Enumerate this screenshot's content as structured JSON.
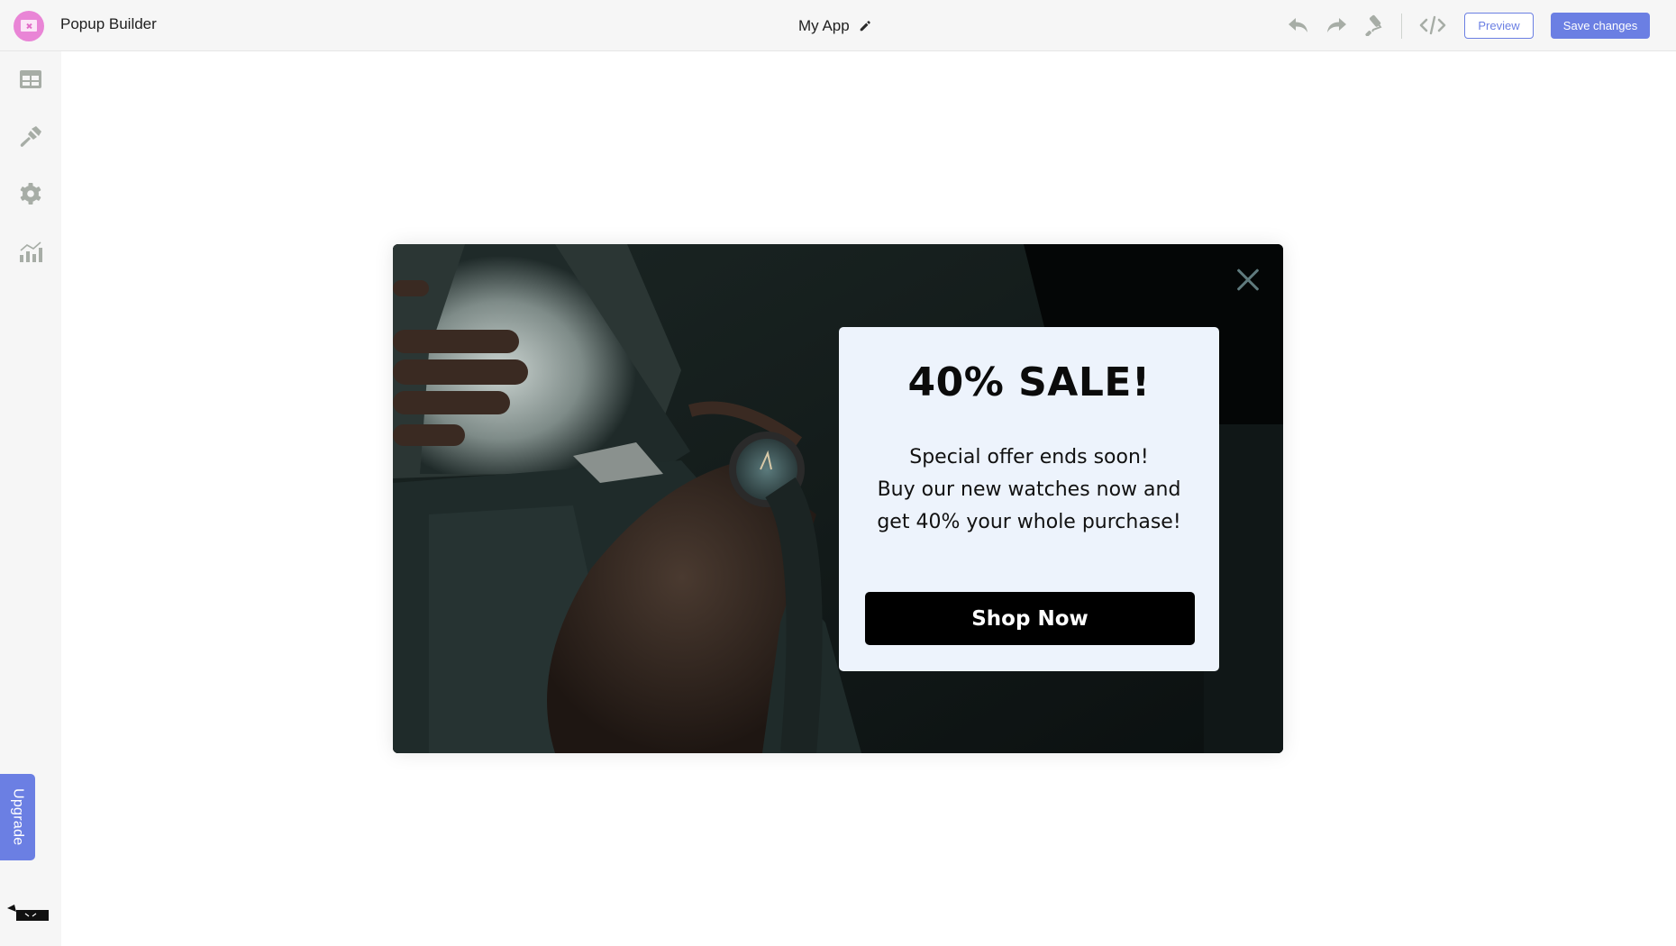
{
  "header": {
    "app_name": "Popup Builder",
    "page_title": "My App",
    "toolbar": {
      "undo_icon": "undo-icon",
      "redo_icon": "redo-icon",
      "theme_icon": "paint-roller-icon",
      "code_icon": "code-icon",
      "preview_label": "Preview",
      "save_label": "Save changes"
    }
  },
  "sidebar": {
    "items": [
      {
        "name": "layout",
        "icon": "table-layout-icon"
      },
      {
        "name": "design",
        "icon": "paint-brush-icon"
      },
      {
        "name": "settings",
        "icon": "gear-icon"
      },
      {
        "name": "analytics",
        "icon": "analytics-chart-icon"
      }
    ],
    "upgrade_label": "Upgrade"
  },
  "popup": {
    "title": "40% SALE!",
    "body_lines": [
      "Special offer ends soon!",
      "Buy our new watches now and",
      "get 40% your whole purchase!"
    ],
    "cta_label": "Shop Now",
    "background_image": "man-in-suit-wearing-wristwatch",
    "colors": {
      "card_bg": "#edf3fc",
      "cta_bg": "#000000",
      "close_icon": "#5f7a7d"
    }
  },
  "colors": {
    "accent": "#6b7fe3",
    "logo": "#e985d6",
    "icon_gray": "#a7ada6"
  }
}
